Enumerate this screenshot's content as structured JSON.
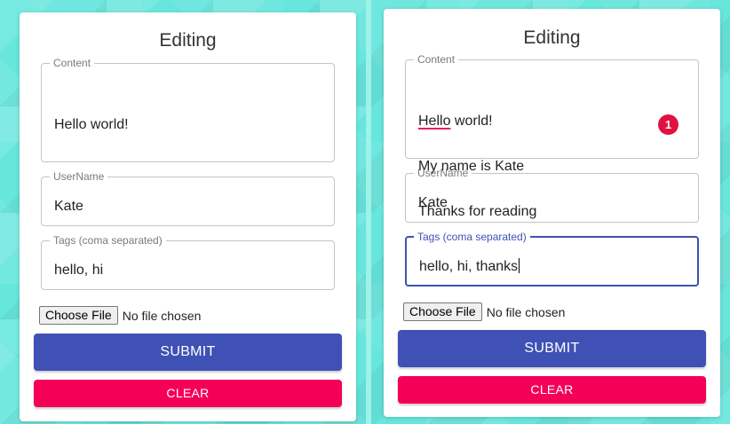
{
  "forms": [
    {
      "title": "Editing",
      "content": {
        "label": "Content",
        "lines": [
          "Hello world!"
        ]
      },
      "username": {
        "label": "UserName",
        "value": "Kate"
      },
      "tags": {
        "label": "Tags (coma separated)",
        "value": "hello, hi"
      },
      "file": {
        "button": "Choose File",
        "status": "No file chosen"
      },
      "submit": "SUBMIT",
      "clear": "CLEAR"
    },
    {
      "title": "Editing",
      "content": {
        "label": "Content",
        "lines": [
          "Hello",
          " world!",
          "My name is Kate",
          "Thanks for reading"
        ],
        "badge": "1"
      },
      "username": {
        "label": "UserName",
        "value": "Kate"
      },
      "tags": {
        "label": "Tags (coma separated)",
        "value": "hello, hi, thanks"
      },
      "file": {
        "button": "Choose File",
        "status": "No file chosen"
      },
      "submit": "SUBMIT",
      "clear": "CLEAR"
    }
  ],
  "colors": {
    "primary": "#3f51b5",
    "secondary": "#f50057",
    "badge": "#e0123f",
    "background": "#67e6dc"
  }
}
